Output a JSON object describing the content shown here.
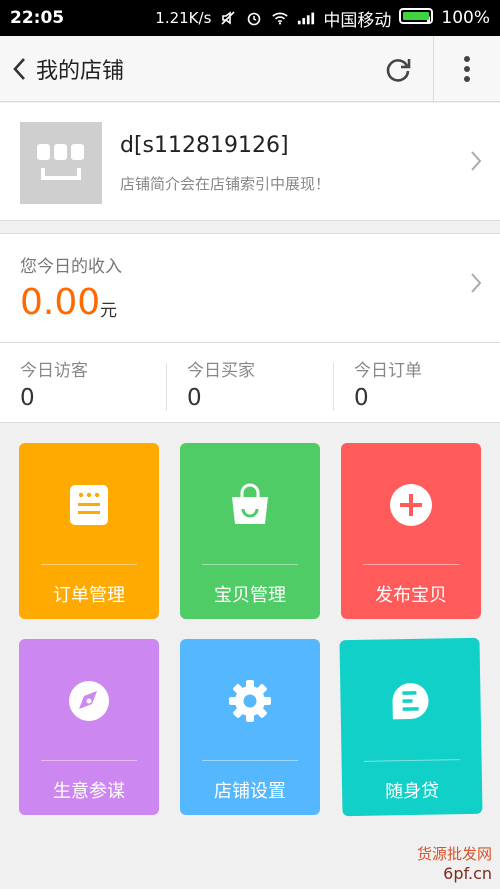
{
  "status_bar": {
    "time": "22:05",
    "speed": "1.21K/s",
    "carrier": "中国移动",
    "battery": "100%",
    "battery_color": "#3fd43f"
  },
  "app_bar": {
    "title": "我的店铺",
    "icons": [
      "back-icon",
      "refresh-icon",
      "more-icon"
    ]
  },
  "shop": {
    "name": "d[s112819126]",
    "description": "店铺简介会在店铺索引中展现！"
  },
  "income": {
    "label": "您今日的收入",
    "amount": "0.00",
    "unit": "元",
    "amount_color": "#ff6a00"
  },
  "stats": [
    {
      "label": "今日访客",
      "value": "0"
    },
    {
      "label": "今日买家",
      "value": "0"
    },
    {
      "label": "今日订单",
      "value": "0"
    }
  ],
  "tiles": [
    {
      "label": "订单管理",
      "icon": "order-icon",
      "color": "#ffaa00"
    },
    {
      "label": "宝贝管理",
      "icon": "bag-icon",
      "color": "#4fcc66"
    },
    {
      "label": "发布宝贝",
      "icon": "plus-circle-icon",
      "color": "#ff5b5b"
    },
    {
      "label": "生意参谋",
      "icon": "compass-icon",
      "color": "#cc88f0"
    },
    {
      "label": "店铺设置",
      "icon": "gear-icon",
      "color": "#55b8ff"
    },
    {
      "label": "随身贷",
      "icon": "loan-icon",
      "color": "#11d0c8"
    }
  ],
  "watermark": {
    "line1": "货源批发网",
    "line2": "6pf.cn"
  }
}
